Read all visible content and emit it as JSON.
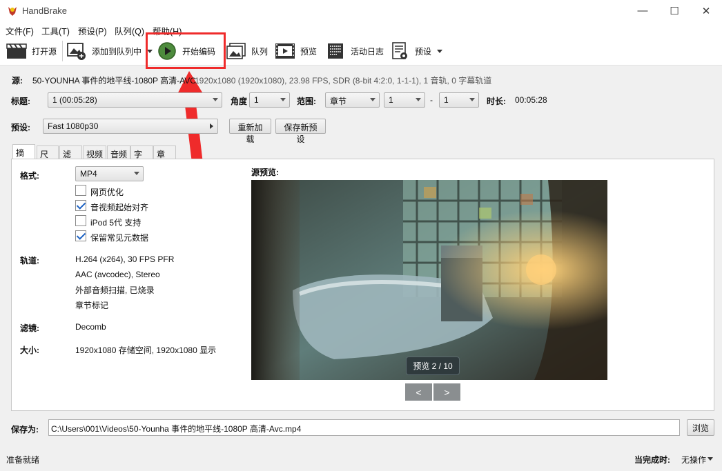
{
  "window": {
    "title": "HandBrake",
    "minimize_glyph": "—",
    "maximize_glyph": "☐",
    "close_glyph": "✕"
  },
  "menu": [
    "文件(F)",
    "工具(T)",
    "预设(P)",
    "队列(Q)",
    "帮助(H)"
  ],
  "toolbar": {
    "open_source": "打开源",
    "add_to_queue": "添加到队列中",
    "start_encode": "开始编码",
    "queue": "队列",
    "preview": "预览",
    "activity_log": "活动日志",
    "presets": "预设"
  },
  "source": {
    "label": "源:",
    "name": "50-YOUNHA 事件的地平线-1080P 高清-AVC",
    "info": "1920x1080 (1920x1080), 23.98 FPS, SDR (8-bit 4:2:0, 1-1-1), 1 音轨, 0 字幕轨道"
  },
  "title_row": {
    "title_label": "标题:",
    "title_value": "1  (00:05:28)",
    "angle_label": "角度",
    "angle_value": "1",
    "range_label": "范围:",
    "range_type": "章节",
    "range_start": "1",
    "range_dash": "-",
    "range_end": "1",
    "duration_label": "时长:",
    "duration_value": "00:05:28"
  },
  "preset_row": {
    "label": "预设:",
    "value": "Fast 1080p30",
    "reload": "重新加载",
    "save_new": "保存新预设"
  },
  "tabs": [
    "摘要",
    "尺寸",
    "滤镜",
    "视频",
    "音频",
    "字幕",
    "章节"
  ],
  "summary": {
    "format_label": "格式:",
    "format_value": "MP4",
    "checkboxes": [
      {
        "label": "网页优化",
        "checked": false
      },
      {
        "label": "音视频起始对齐",
        "checked": true
      },
      {
        "label": "iPod 5代 支持",
        "checked": false
      },
      {
        "label": "保留常见元数据",
        "checked": true
      }
    ],
    "tracks_label": "轨道:",
    "tracks": [
      "H.264 (x264), 30 FPS PFR",
      "AAC (avcodec), Stereo",
      "外部音频扫描, 已烧录",
      "章节标记"
    ],
    "filters_label": "滤镜:",
    "filters_value": "Decomb",
    "size_label": "大小:",
    "size_value": "1920x1080 存储空间, 1920x1080 显示",
    "preview_label": "源预览:",
    "preview_badge": "预览 2 / 10",
    "prev": "<",
    "next": ">"
  },
  "destination": {
    "label": "保存为:",
    "path": "C:\\Users\\001\\Videos\\50-Younha 事件的地平线-1080P 高清-Avc.mp4",
    "browse": "浏览"
  },
  "status": {
    "left": "准备就绪",
    "when_done_label": "当完成时:",
    "when_done_value": "无操作"
  },
  "colors": {
    "highlight": "#ef2b2b",
    "accent": "#1e63c4"
  }
}
